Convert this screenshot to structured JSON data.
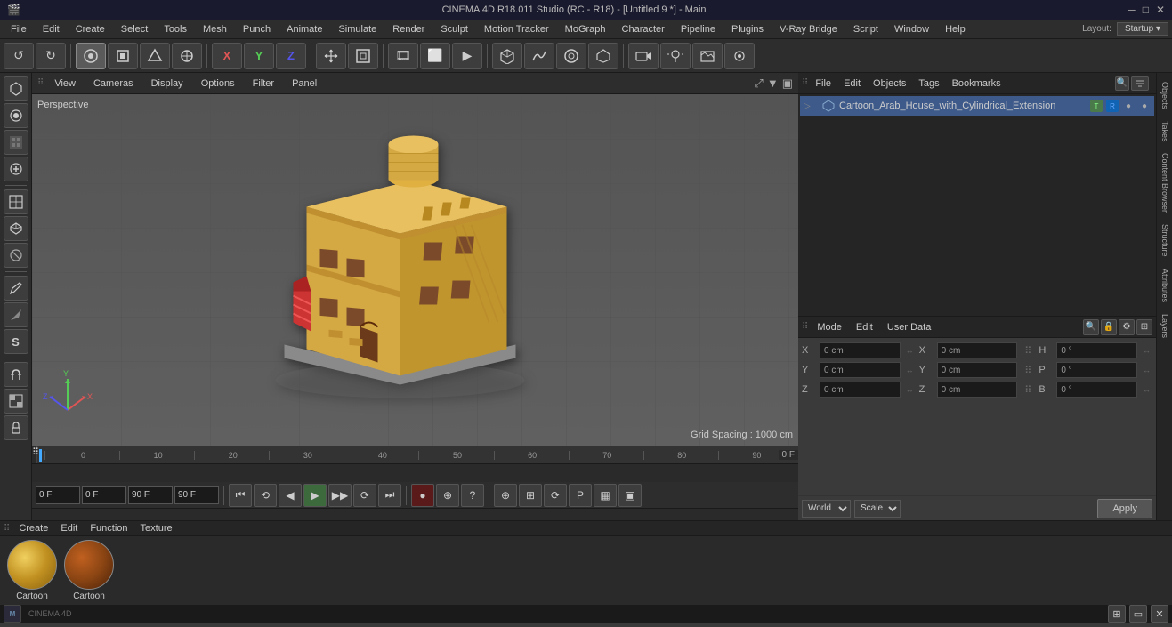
{
  "titlebar": {
    "title": "CINEMA 4D R18.011 Studio (RC - R18) - [Untitled 9 *] - Main",
    "min": "─",
    "max": "□",
    "close": "✕"
  },
  "menubar": {
    "items": [
      "File",
      "Edit",
      "Create",
      "Select",
      "Tools",
      "Mesh",
      "Punch",
      "Animate",
      "Simulate",
      "Render",
      "Sculpt",
      "Motion Tracker",
      "MoGraph",
      "Character",
      "Pipeline",
      "Plugins",
      "V-Ray Bridge",
      "Script",
      "Window",
      "Help"
    ]
  },
  "toolbar": {
    "undo_label": "↺",
    "redo_label": "↻"
  },
  "viewport": {
    "label": "Perspective",
    "grid_info": "Grid Spacing : 1000 cm",
    "toolbar_items": [
      "View",
      "Cameras",
      "Display",
      "Options",
      "Filter",
      "Panel"
    ]
  },
  "timeline": {
    "start_frame": "0 F",
    "current_frame": "0 F",
    "end_frame": "90 F",
    "preview_end": "90 F",
    "time_marks": [
      "0",
      "10",
      "20",
      "30",
      "40",
      "50",
      "60",
      "70",
      "80",
      "90"
    ],
    "frame_display": "0 F"
  },
  "objects_panel": {
    "toolbar": [
      "File",
      "Edit",
      "Objects",
      "Tags",
      "Bookmarks"
    ],
    "object_name": "Cartoon_Arab_House_with_Cylindrical_Extension",
    "object_icon": "▣",
    "tag_color": "#4a8a4a"
  },
  "attributes_panel": {
    "toolbar": [
      "Mode",
      "Edit",
      "User Data"
    ],
    "fields": {
      "x_label": "X",
      "x_pos": "0 cm",
      "x_size_label": "X",
      "x_size": "0 cm",
      "h_label": "H",
      "h_val": "0 °",
      "y_label": "Y",
      "y_pos": "0 cm",
      "y_size_label": "Y",
      "y_size": "0 cm",
      "p_label": "P",
      "p_val": "0 °",
      "z_label": "Z",
      "z_pos": "0 cm",
      "z_size_label": "Z",
      "z_size": "0 cm",
      "b_label": "B",
      "b_val": "0 °"
    },
    "coord_system": "World",
    "scale_mode": "Scale",
    "apply_btn": "Apply"
  },
  "materials": {
    "toolbar": [
      "Create",
      "Edit",
      "Function",
      "Texture"
    ],
    "items": [
      {
        "name": "Cartoon",
        "type": "sphere",
        "color": "#d4a843"
      },
      {
        "name": "Cartoon",
        "type": "sphere_rough",
        "color": "#8b4513"
      }
    ]
  },
  "right_tabs": [
    "Objects",
    "Takes",
    "Content Browser",
    "Structure",
    "Attributes",
    "Layers"
  ],
  "left_tools": [
    "▣",
    "◈",
    "✦",
    "⊕",
    "↺",
    "▷",
    "⊞",
    "△",
    "○",
    "□",
    "◇",
    "╱",
    "⊙",
    "S",
    "◉",
    "⬡"
  ],
  "playback_btns": [
    "⏮",
    "⟲",
    "◀",
    "▶",
    "▶▶",
    "⟳",
    "⏭"
  ],
  "bottom_icons": [
    "⊕",
    "⊞",
    "⟳",
    "P",
    "▦",
    "▣"
  ]
}
